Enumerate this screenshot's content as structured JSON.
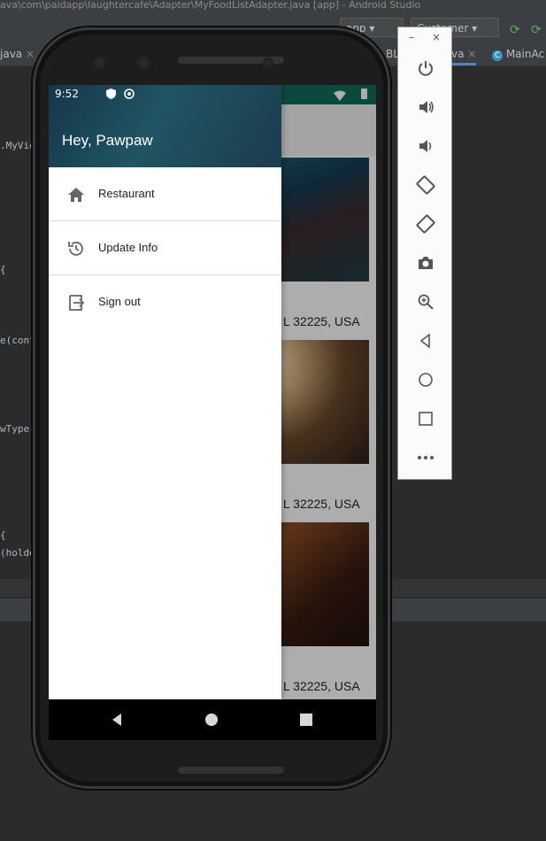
{
  "ide": {
    "title": "ava\\com\\paidapp\\laughtercafe\\Adapter\\MyFoodListAdapter.java [app] - Android Studio",
    "run_config": "app",
    "device": "Customer",
    "tabs": [
      {
        "label": "java"
      },
      {
        "label": "BL"
      },
      {
        "label": "va"
      },
      {
        "label": "MainAc"
      }
    ],
    "code_lines": [
      ".MyVie",
      "{",
      "e(cont",
      "wType)",
      "{",
      "(holde"
    ]
  },
  "emulator": {
    "minimize": "–",
    "close": "×",
    "buttons": [
      "power-icon",
      "volume-up-icon",
      "volume-down-icon",
      "rotate-left-icon",
      "rotate-right-icon",
      "camera-icon",
      "zoom-icon",
      "back-icon",
      "home-icon",
      "overview-icon",
      "more-icon"
    ]
  },
  "status_bar": {
    "time": "9:52"
  },
  "drawer": {
    "greeting": "Hey, Pawpaw",
    "items": [
      {
        "label": "Restaurant",
        "icon": "home-icon"
      },
      {
        "label": "Update Info",
        "icon": "history-icon"
      },
      {
        "label": "Sign out",
        "icon": "exit-icon"
      }
    ]
  },
  "background_list": {
    "addresses": [
      "L 32225, USA",
      "L 32225, USA",
      "L 32225, USA"
    ]
  },
  "colors": {
    "drawer_header": "#1f5563",
    "app_status": "#0f6e5c",
    "scrim": "rgba(0,0,0,0.32)"
  }
}
